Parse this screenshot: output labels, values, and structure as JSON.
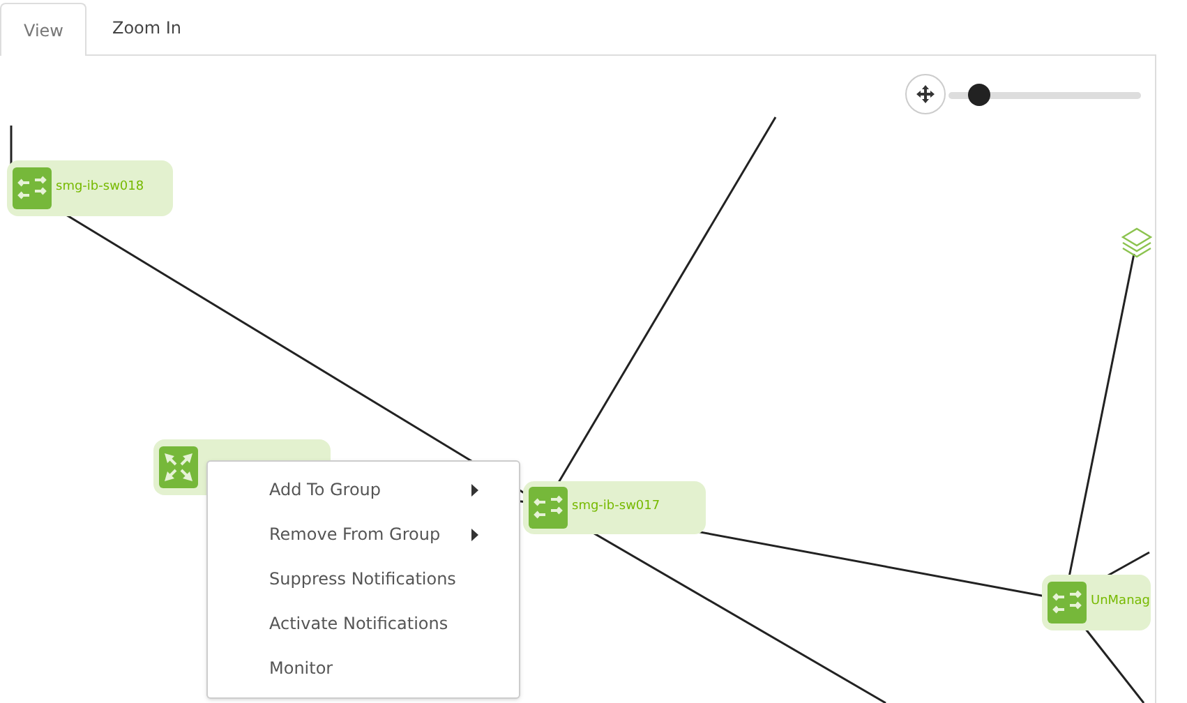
{
  "tabs": [
    {
      "label": "View",
      "selected": true
    },
    {
      "label": "Zoom In",
      "selected": false
    }
  ],
  "zoom_slider": {
    "level": 0.1
  },
  "nodes": [
    {
      "kind": "switch",
      "label": "smg-ib-sw018"
    },
    {
      "kind": "group"
    },
    {
      "kind": "switch",
      "label": "smg-ib-sw017"
    },
    {
      "kind": "switch",
      "label": "UnManag"
    }
  ],
  "context_menu": {
    "items": [
      {
        "label": "Add To Group",
        "submenu": true
      },
      {
        "label": "Remove From Group",
        "submenu": true
      },
      {
        "label": "Suppress Notifications",
        "submenu": false
      },
      {
        "label": "Activate Notifications",
        "submenu": false
      },
      {
        "label": "Monitor",
        "submenu": false
      }
    ]
  }
}
